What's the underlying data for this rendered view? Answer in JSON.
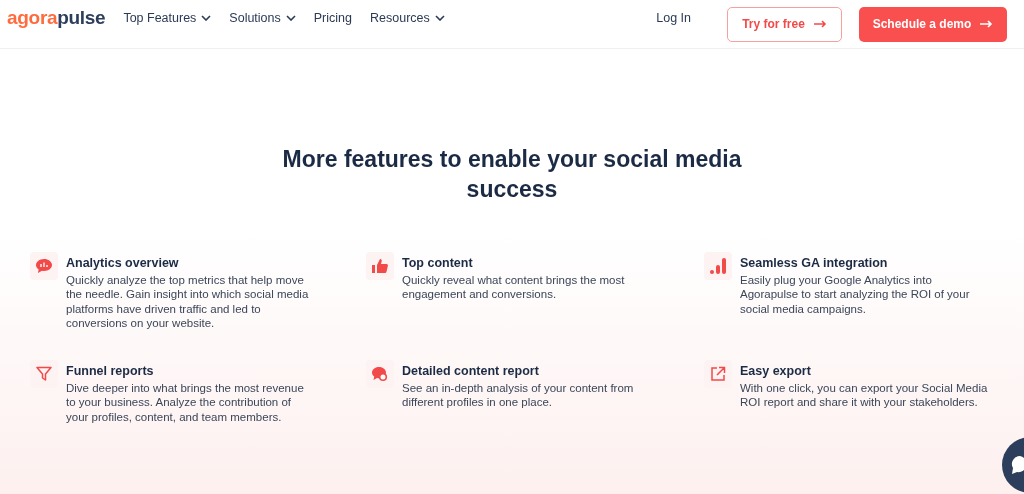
{
  "logo": {
    "first": "agora",
    "second": "pulse"
  },
  "nav": [
    {
      "label": "Top Features",
      "dropdown": true
    },
    {
      "label": "Solutions",
      "dropdown": true
    },
    {
      "label": "Pricing",
      "dropdown": false
    },
    {
      "label": "Resources",
      "dropdown": true
    }
  ],
  "login": "Log In",
  "try_button": "Try for free",
  "demo_button": "Schedule a demo",
  "heading": "More features to enable your social media success",
  "features": [
    {
      "kind": "chat-chart",
      "title": "Analytics overview",
      "text": "Quickly analyze the top metrics that help move the needle. Gain insight into which social media platforms have driven traffic and led to conversions on your website."
    },
    {
      "kind": "thumb",
      "title": "Top content",
      "text": "Quickly reveal what content brings the most engagement and conversions."
    },
    {
      "kind": "bars",
      "title": "Seamless GA integration",
      "text": "Easily plug your Google Analytics into Agorapulse to start analyzing the ROI of your social media campaigns."
    },
    {
      "kind": "funnel",
      "title": "Funnel reports",
      "text": "Dive deeper into what brings the most revenue to your business. Analyze the contribution of your profiles, content, and team members."
    },
    {
      "kind": "chat-gear",
      "title": "Detailed content report",
      "text": "See an in-depth analysis of your content from different profiles in one place."
    },
    {
      "kind": "export",
      "title": "Easy export",
      "text": "With one click, you can export your Social Media ROI report and share it with your stakeholders."
    }
  ]
}
